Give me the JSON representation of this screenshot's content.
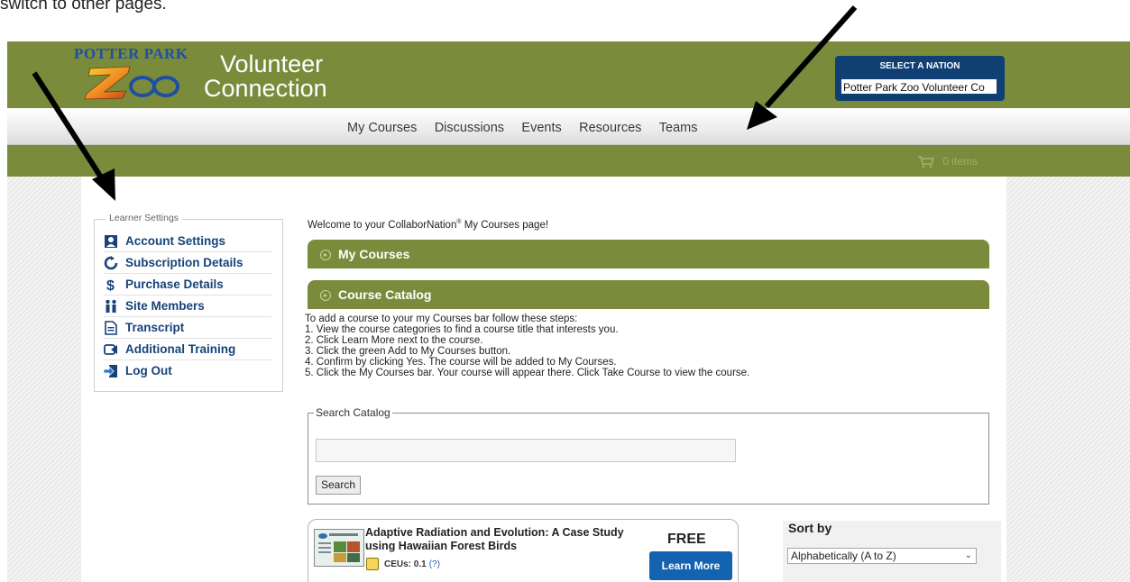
{
  "caption": "switch to other pages.",
  "header": {
    "logo_text": "POTTER PARK",
    "logo_mark": "Zoo",
    "title_line1": "Volunteer",
    "title_line2": "Connection",
    "nation_label": "SELECT A NATION",
    "nation_value": "Potter Park Zoo Volunteer Co"
  },
  "nav": {
    "items": [
      "My Courses",
      "Discussions",
      "Events",
      "Resources",
      "Teams"
    ]
  },
  "cart": {
    "label": "0 items",
    "icon": "cart-icon"
  },
  "learner": {
    "legend": "Learner Settings",
    "items": [
      {
        "label": "Account Settings",
        "icon": "account-icon"
      },
      {
        "label": "Subscription Details",
        "icon": "refresh-icon"
      },
      {
        "label": "Purchase Details",
        "icon": "dollar-icon"
      },
      {
        "label": "Site Members",
        "icon": "members-icon"
      },
      {
        "label": "Transcript",
        "icon": "document-icon"
      },
      {
        "label": "Additional Training",
        "icon": "training-icon"
      },
      {
        "label": "Log Out",
        "icon": "logout-icon"
      }
    ]
  },
  "main": {
    "welcome_prefix": "Welcome to your CollaborNation",
    "welcome_reg": "®",
    "welcome_suffix": " My Courses page!",
    "my_courses_label": "My Courses",
    "catalog_label": "Course Catalog",
    "instructions": [
      "To add a course to your my Courses bar follow these steps:",
      "1. View the course categories to find a course title that interests you.",
      "2. Click Learn More next to the course.",
      "3. Click the green Add to My Courses button.",
      "4. Confirm by clicking Yes. The course will be added to My Courses.",
      "5. Click the My Courses bar. Your course will appear there. Click Take Course to view the course."
    ],
    "search": {
      "legend": "Search Catalog",
      "value": "",
      "button": "Search"
    },
    "course": {
      "title": "Adaptive Radiation and Evolution: A Case Study using Hawaiian Forest Birds",
      "ceu_label": "CEUs: 0.1",
      "ceu_help": "(?)",
      "price": "FREE",
      "button": "Learn More"
    },
    "sort": {
      "label": "Sort by",
      "value": "Alphabetically (A to Z)"
    }
  },
  "colors": {
    "header_green": "#7b8b3c",
    "nav_blue": "#17437a",
    "button_blue": "#1463b0"
  }
}
